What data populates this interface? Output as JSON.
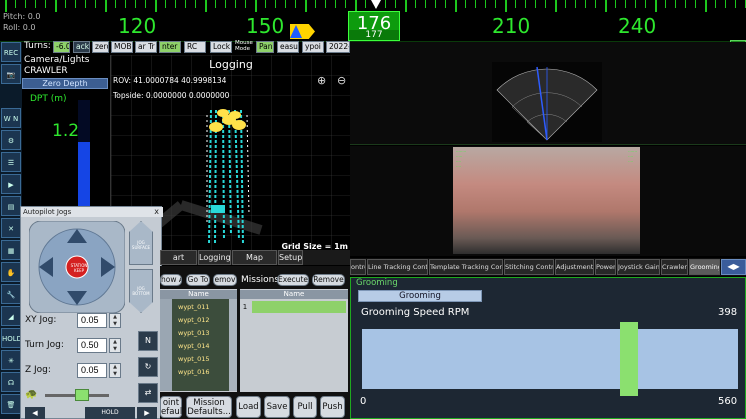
{
  "hud": {
    "pitch": "Pitch: 0.0",
    "roll": "Roll: 0.0",
    "heading_value": "176",
    "heading_sub": "177",
    "compass_labels": [
      "120",
      "150",
      "210",
      "240"
    ]
  },
  "left_column": {
    "buttons": [
      "REC",
      "camera",
      "W N E",
      "settings",
      "list",
      "play",
      "vehicle",
      "tools",
      "grid",
      "hand",
      "wrench",
      "tilt",
      "HOLD",
      "target",
      "stethoscope",
      "trash"
    ]
  },
  "toolbar": {
    "turns_label": "Turns:",
    "turns_value": "-6.0",
    "buttons": [
      "ack",
      "zero",
      "MOB",
      "ar Tr",
      "nter",
      "RC",
      "Lock",
      "Mouse Mode",
      "Pan",
      "easu",
      "ypoi",
      "2022-"
    ]
  },
  "depth": {
    "title_line1": "Camera/Lights",
    "title_line2": "CRAWLER",
    "zero_depth_label": "Zero Depth",
    "unit_label": "DPT (m)",
    "value": "1.2",
    "fill_fraction": 0.6
  },
  "tracker": {
    "title": "Logging",
    "rov_position": "ROV: 41.0000784 40.9998134",
    "topside_position": "Topside: 0.0000000 0.0000000",
    "grid_size": "Grid Size = 1m"
  },
  "autopilot": {
    "title": "Autopilot Jogs",
    "close": "x",
    "station_keep": "STATION KEEP",
    "jog_surface": "JOG SURFACE",
    "jog_bottom": "JOG BOTTOM",
    "xy_jog_label": "XY Jog:",
    "xy_jog_value": "0.05",
    "turn_jog_label": "Turn Jog:",
    "turn_jog_value": "0.50",
    "z_jog_label": "Z Jog:",
    "z_jog_value": "0.05",
    "hold_label": "HOLD"
  },
  "waypoints": {
    "tabs": [
      "art Items",
      "Logging",
      "Map Config",
      "Setup"
    ],
    "buttons": [
      "how A",
      "Go To",
      "emov",
      "Execute",
      "Remove"
    ],
    "missions_label": "Missions",
    "column_name": "Name",
    "mission_column_name": "Name",
    "rows": [
      "wypt_011",
      "wypt_012",
      "wypt_013",
      "wypt_014",
      "wypt_015",
      "wypt_016"
    ],
    "mission_row_index": "1",
    "bottom_buttons": [
      "oint\nefaults...",
      "Mission\nDefaults...",
      "Load",
      "Save",
      "Pull",
      "Push"
    ]
  },
  "control_tabs": {
    "items": [
      "ontrol",
      "Line Tracking Control",
      "Template Tracking Control",
      "Stitching Control",
      "Adjustments",
      "Power",
      "Joystick Gains",
      "Crawler",
      "Grooming"
    ],
    "active": "Grooming",
    "arrows": "◀▶"
  },
  "grooming": {
    "panel_label": "Grooming",
    "button_label": "Grooming",
    "speed_label": "Grooming Speed RPM",
    "current_value": "398",
    "min": "0",
    "max": "560",
    "value_fraction": 0.711
  },
  "colors": {
    "hud_green": "#2ee82e",
    "accent_blue": "#3c5e92",
    "slider_track": "#a7c3e4",
    "slider_handle": "#8be06f"
  }
}
